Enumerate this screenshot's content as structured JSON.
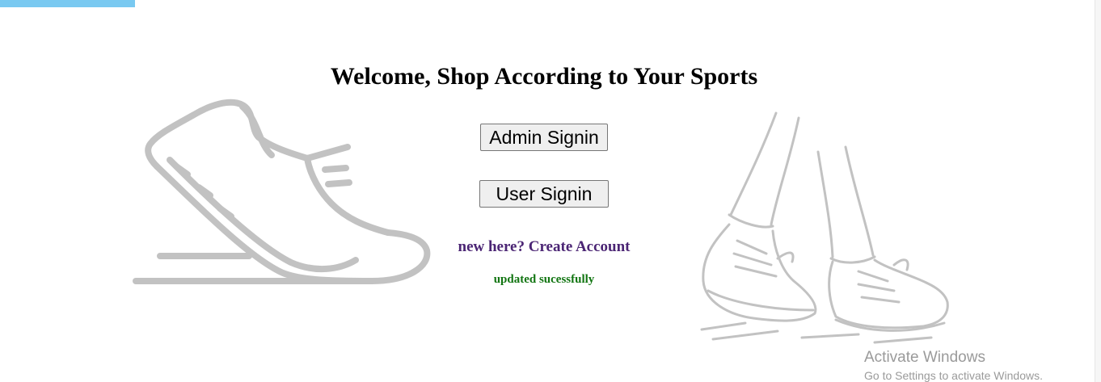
{
  "header": {
    "title": "Welcome, Shop According to Your Sports"
  },
  "actions": {
    "admin_signin": "Admin Signin",
    "user_signin": "User Signin",
    "create_account": "new here? Create Account"
  },
  "status": {
    "message": "updated sucessfully"
  },
  "watermark": {
    "title": "Activate Windows",
    "subtitle": "Go to Settings to activate Windows."
  },
  "colors": {
    "accent_bar": "#79c9f1",
    "link": "#4b2574",
    "success": "#127512",
    "illustration": "#c2c2c2"
  },
  "illustrations": {
    "left": "running-shoe-icon",
    "right": "walking-sneakers-icon"
  }
}
